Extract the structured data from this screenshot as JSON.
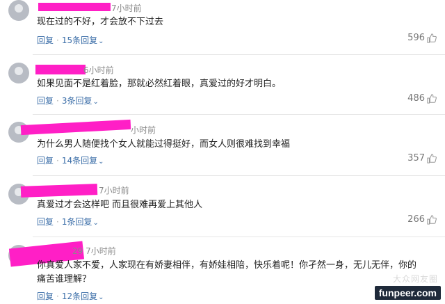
{
  "comments": [
    {
      "time": "7小时前",
      "text": "现在过的不好，才会放不下过去",
      "reply": "回复",
      "replies": "15条回复",
      "likes": "596"
    },
    {
      "time": "6小时前",
      "text": "如果见面不是红着脸，那就必然红着眼，真爱过的好才明白。",
      "reply": "回复",
      "replies": "3条回复",
      "likes": "486"
    },
    {
      "time": "小时前",
      "text": "为什么男人随便找个女人就能过得挺好，而女人则很难找到幸福",
      "reply": "回复",
      "replies": "14条回复",
      "likes": "357"
    },
    {
      "time": "7小时前",
      "text": "真爱过才会这样吧 而且很难再爱上其他人",
      "reply": "回复",
      "replies": "1条回复",
      "likes": "266"
    },
    {
      "time": "29 7小时前",
      "text": "你真爱人家不爱，人家现在有娇妻相伴，有娇娃相陪，快乐着呢！你孑然一身，无儿无伴，你的痛苦谁理解？",
      "reply": "回复",
      "replies": "12条回复",
      "likes": ""
    }
  ],
  "watermark": "funpeer.com",
  "watermark_faint": "大众网友圈",
  "icons": {
    "like": "thumbs-up-icon",
    "expand": "chevron-down-icon"
  },
  "colors": {
    "redaction": "#ff1fc6",
    "link": "#3b6ea8"
  }
}
